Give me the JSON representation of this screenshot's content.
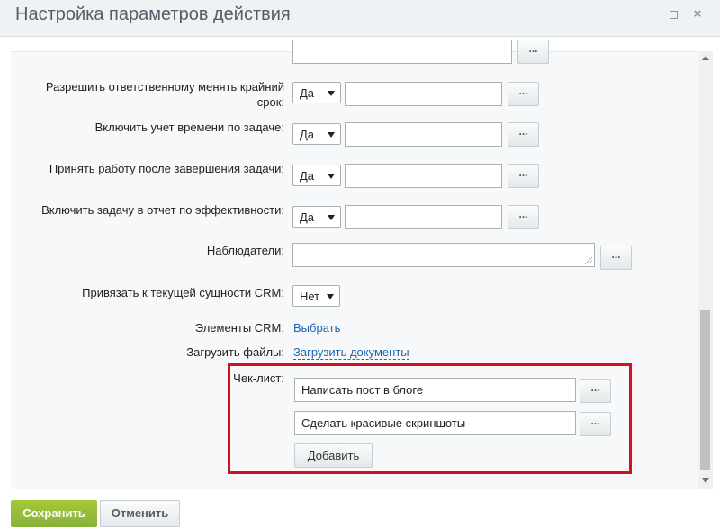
{
  "window": {
    "title": "Настройка параметров действия",
    "maximize_icon": "maximize-icon",
    "close_label": "×"
  },
  "fields": {
    "allow_deadline_change": {
      "label": "Разрешить ответственному менять крайний срок:",
      "select_value": "Да",
      "text_value": "",
      "more_label": "..."
    },
    "time_tracking": {
      "label": "Включить учет времени по задаче:",
      "select_value": "Да",
      "text_value": "",
      "more_label": "..."
    },
    "accept_after_completion": {
      "label": "Принять работу после завершения задачи:",
      "select_value": "Да",
      "text_value": "",
      "more_label": "..."
    },
    "efficiency_report": {
      "label": "Включить задачу в отчет по эффективности:",
      "select_value": "Да",
      "text_value": "",
      "more_label": "..."
    },
    "observers": {
      "label": "Наблюдатели:",
      "text_value": "",
      "more_label": "..."
    },
    "crm_binding": {
      "label": "Привязать к текущей сущности CRM:",
      "select_value": "Нет"
    },
    "crm_elements": {
      "label": "Элементы CRM:",
      "link": "Выбрать"
    },
    "upload_files": {
      "label": "Загрузить файлы:",
      "link": "Загрузить документы"
    },
    "checklist": {
      "label": "Чек-лист:",
      "items": [
        {
          "value": "Написать пост в блоге",
          "more_label": "..."
        },
        {
          "value": "Сделать красивые скриншоты",
          "more_label": "..."
        }
      ],
      "add_label": "Добавить"
    },
    "top_partial": {
      "text_value": "",
      "more_label": "..."
    }
  },
  "footer": {
    "save_label": "Сохранить",
    "cancel_label": "Отменить"
  },
  "colors": {
    "accent_green": "#9bc23a",
    "highlight_red": "#d3121f",
    "link_blue": "#2067b0"
  }
}
